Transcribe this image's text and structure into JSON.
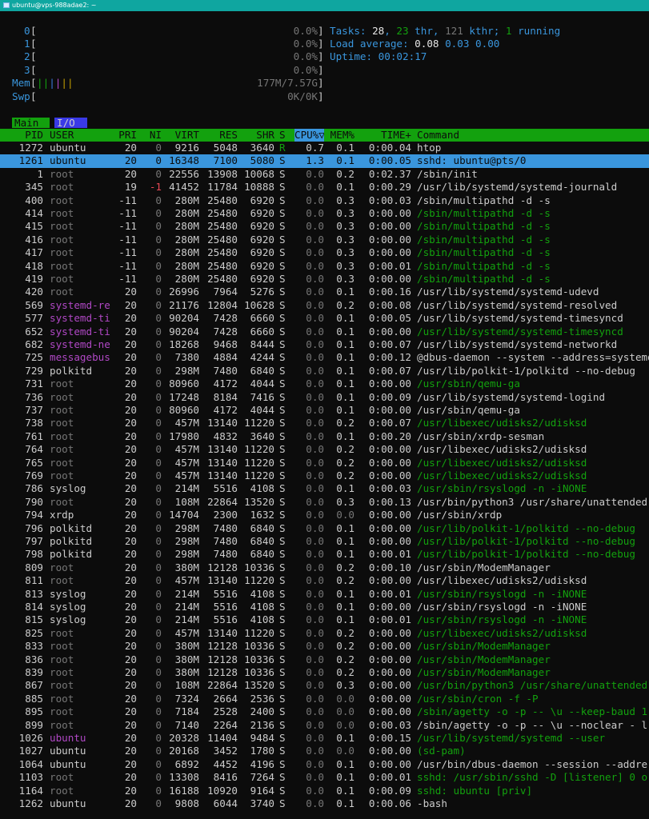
{
  "window": {
    "title": "ubuntu@vps-988adae2: ~"
  },
  "meters": {
    "cpus": [
      {
        "label": "0",
        "value": "0.0%"
      },
      {
        "label": "1",
        "value": "0.0%"
      },
      {
        "label": "2",
        "value": "0.0%"
      },
      {
        "label": "3",
        "value": "0.0%"
      }
    ],
    "mem": {
      "label": "Mem",
      "value": "177M/7.57G"
    },
    "swp": {
      "label": "Swp",
      "value": "0K/0K"
    },
    "tasks": {
      "label": "Tasks: ",
      "procs": "28",
      "sep1": ", ",
      "thr": "23",
      "thr_label": " thr, ",
      "kthr": "121",
      "kthr_label": " kthr; ",
      "running": "1",
      "running_label": " running"
    },
    "load": {
      "label": "Load average: ",
      "l1": "0.08",
      "l5": "0.03",
      "l15": "0.00"
    },
    "uptime": {
      "label": "Uptime: ",
      "value": "00:02:17"
    }
  },
  "tabs": [
    {
      "label": "Main"
    },
    {
      "label": "I/O"
    }
  ],
  "columns": [
    "PID",
    "USER",
    "PRI",
    "NI",
    "VIRT",
    "RES",
    "SHR",
    "S",
    "CPU%▽",
    "MEM%",
    "TIME+",
    "Command"
  ],
  "processes": [
    [
      "1272",
      "ubuntu",
      "20",
      "0",
      "9216",
      "5048",
      "3640",
      "R",
      "0.7",
      "0.1",
      "0:00.04",
      "htop"
    ],
    [
      "1261",
      "ubuntu",
      "20",
      "0",
      "16348",
      "7100",
      "5080",
      "S",
      "1.3",
      "0.1",
      "0:00.05",
      "sshd: ubuntu@pts/0"
    ],
    [
      "1",
      "root",
      "20",
      "0",
      "22556",
      "13908",
      "10068",
      "S",
      "0.0",
      "0.2",
      "0:02.37",
      "/sbin/init"
    ],
    [
      "345",
      "root",
      "19",
      "-1",
      "41452",
      "11784",
      "10888",
      "S",
      "0.0",
      "0.1",
      "0:00.29",
      "/usr/lib/systemd/systemd-journald"
    ],
    [
      "400",
      "root",
      "-11",
      "0",
      "280M",
      "25480",
      "6920",
      "S",
      "0.0",
      "0.3",
      "0:00.03",
      "/sbin/multipathd -d -s"
    ],
    [
      "414",
      "root",
      "-11",
      "0",
      "280M",
      "25480",
      "6920",
      "S",
      "0.0",
      "0.3",
      "0:00.00",
      "/sbin/multipathd -d -s"
    ],
    [
      "415",
      "root",
      "-11",
      "0",
      "280M",
      "25480",
      "6920",
      "S",
      "0.0",
      "0.3",
      "0:00.00",
      "/sbin/multipathd -d -s"
    ],
    [
      "416",
      "root",
      "-11",
      "0",
      "280M",
      "25480",
      "6920",
      "S",
      "0.0",
      "0.3",
      "0:00.00",
      "/sbin/multipathd -d -s"
    ],
    [
      "417",
      "root",
      "-11",
      "0",
      "280M",
      "25480",
      "6920",
      "S",
      "0.0",
      "0.3",
      "0:00.00",
      "/sbin/multipathd -d -s"
    ],
    [
      "418",
      "root",
      "-11",
      "0",
      "280M",
      "25480",
      "6920",
      "S",
      "0.0",
      "0.3",
      "0:00.01",
      "/sbin/multipathd -d -s"
    ],
    [
      "419",
      "root",
      "-11",
      "0",
      "280M",
      "25480",
      "6920",
      "S",
      "0.0",
      "0.3",
      "0:00.00",
      "/sbin/multipathd -d -s"
    ],
    [
      "420",
      "root",
      "20",
      "0",
      "26996",
      "7964",
      "5276",
      "S",
      "0.0",
      "0.1",
      "0:00.16",
      "/usr/lib/systemd/systemd-udevd"
    ],
    [
      "569",
      "systemd-re",
      "20",
      "0",
      "21176",
      "12804",
      "10628",
      "S",
      "0.0",
      "0.2",
      "0:00.08",
      "/usr/lib/systemd/systemd-resolved"
    ],
    [
      "577",
      "systemd-ti",
      "20",
      "0",
      "90204",
      "7428",
      "6660",
      "S",
      "0.0",
      "0.1",
      "0:00.05",
      "/usr/lib/systemd/systemd-timesyncd"
    ],
    [
      "652",
      "systemd-ti",
      "20",
      "0",
      "90204",
      "7428",
      "6660",
      "S",
      "0.0",
      "0.1",
      "0:00.00",
      "/usr/lib/systemd/systemd-timesyncd"
    ],
    [
      "682",
      "systemd-ne",
      "20",
      "0",
      "18268",
      "9468",
      "8444",
      "S",
      "0.0",
      "0.1",
      "0:00.07",
      "/usr/lib/systemd/systemd-networkd"
    ],
    [
      "725",
      "messagebus",
      "20",
      "0",
      "7380",
      "4884",
      "4244",
      "S",
      "0.0",
      "0.1",
      "0:00.12",
      "@dbus-daemon --system --address=systemd"
    ],
    [
      "729",
      "polkitd",
      "20",
      "0",
      "298M",
      "7480",
      "6840",
      "S",
      "0.0",
      "0.1",
      "0:00.07",
      "/usr/lib/polkit-1/polkitd --no-debug"
    ],
    [
      "731",
      "root",
      "20",
      "0",
      "80960",
      "4172",
      "4044",
      "S",
      "0.0",
      "0.1",
      "0:00.00",
      "/usr/sbin/qemu-ga"
    ],
    [
      "736",
      "root",
      "20",
      "0",
      "17248",
      "8184",
      "7416",
      "S",
      "0.0",
      "0.1",
      "0:00.09",
      "/usr/lib/systemd/systemd-logind"
    ],
    [
      "737",
      "root",
      "20",
      "0",
      "80960",
      "4172",
      "4044",
      "S",
      "0.0",
      "0.1",
      "0:00.00",
      "/usr/sbin/qemu-ga"
    ],
    [
      "738",
      "root",
      "20",
      "0",
      "457M",
      "13140",
      "11220",
      "S",
      "0.0",
      "0.2",
      "0:00.07",
      "/usr/libexec/udisks2/udisksd"
    ],
    [
      "761",
      "root",
      "20",
      "0",
      "17980",
      "4832",
      "3640",
      "S",
      "0.0",
      "0.1",
      "0:00.20",
      "/usr/sbin/xrdp-sesman"
    ],
    [
      "764",
      "root",
      "20",
      "0",
      "457M",
      "13140",
      "11220",
      "S",
      "0.0",
      "0.2",
      "0:00.00",
      "/usr/libexec/udisks2/udisksd"
    ],
    [
      "765",
      "root",
      "20",
      "0",
      "457M",
      "13140",
      "11220",
      "S",
      "0.0",
      "0.2",
      "0:00.00",
      "/usr/libexec/udisks2/udisksd"
    ],
    [
      "769",
      "root",
      "20",
      "0",
      "457M",
      "13140",
      "11220",
      "S",
      "0.0",
      "0.2",
      "0:00.00",
      "/usr/libexec/udisks2/udisksd"
    ],
    [
      "786",
      "syslog",
      "20",
      "0",
      "214M",
      "5516",
      "4108",
      "S",
      "0.0",
      "0.1",
      "0:00.03",
      "/usr/sbin/rsyslogd -n -iNONE"
    ],
    [
      "790",
      "root",
      "20",
      "0",
      "108M",
      "22864",
      "13520",
      "S",
      "0.0",
      "0.3",
      "0:00.13",
      "/usr/bin/python3 /usr/share/unattended"
    ],
    [
      "794",
      "xrdp",
      "20",
      "0",
      "14704",
      "2300",
      "1632",
      "S",
      "0.0",
      "0.0",
      "0:00.00",
      "/usr/sbin/xrdp"
    ],
    [
      "796",
      "polkitd",
      "20",
      "0",
      "298M",
      "7480",
      "6840",
      "S",
      "0.0",
      "0.1",
      "0:00.00",
      "/usr/lib/polkit-1/polkitd --no-debug"
    ],
    [
      "797",
      "polkitd",
      "20",
      "0",
      "298M",
      "7480",
      "6840",
      "S",
      "0.0",
      "0.1",
      "0:00.00",
      "/usr/lib/polkit-1/polkitd --no-debug"
    ],
    [
      "798",
      "polkitd",
      "20",
      "0",
      "298M",
      "7480",
      "6840",
      "S",
      "0.0",
      "0.1",
      "0:00.01",
      "/usr/lib/polkit-1/polkitd --no-debug"
    ],
    [
      "809",
      "root",
      "20",
      "0",
      "380M",
      "12128",
      "10336",
      "S",
      "0.0",
      "0.2",
      "0:00.10",
      "/usr/sbin/ModemManager"
    ],
    [
      "811",
      "root",
      "20",
      "0",
      "457M",
      "13140",
      "11220",
      "S",
      "0.0",
      "0.2",
      "0:00.00",
      "/usr/libexec/udisks2/udisksd"
    ],
    [
      "813",
      "syslog",
      "20",
      "0",
      "214M",
      "5516",
      "4108",
      "S",
      "0.0",
      "0.1",
      "0:00.01",
      "/usr/sbin/rsyslogd -n -iNONE"
    ],
    [
      "814",
      "syslog",
      "20",
      "0",
      "214M",
      "5516",
      "4108",
      "S",
      "0.0",
      "0.1",
      "0:00.00",
      "/usr/sbin/rsyslogd -n -iNONE"
    ],
    [
      "815",
      "syslog",
      "20",
      "0",
      "214M",
      "5516",
      "4108",
      "S",
      "0.0",
      "0.1",
      "0:00.01",
      "/usr/sbin/rsyslogd -n -iNONE"
    ],
    [
      "825",
      "root",
      "20",
      "0",
      "457M",
      "13140",
      "11220",
      "S",
      "0.0",
      "0.2",
      "0:00.00",
      "/usr/libexec/udisks2/udisksd"
    ],
    [
      "833",
      "root",
      "20",
      "0",
      "380M",
      "12128",
      "10336",
      "S",
      "0.0",
      "0.2",
      "0:00.00",
      "/usr/sbin/ModemManager"
    ],
    [
      "836",
      "root",
      "20",
      "0",
      "380M",
      "12128",
      "10336",
      "S",
      "0.0",
      "0.2",
      "0:00.00",
      "/usr/sbin/ModemManager"
    ],
    [
      "839",
      "root",
      "20",
      "0",
      "380M",
      "12128",
      "10336",
      "S",
      "0.0",
      "0.2",
      "0:00.00",
      "/usr/sbin/ModemManager"
    ],
    [
      "867",
      "root",
      "20",
      "0",
      "108M",
      "22864",
      "13520",
      "S",
      "0.0",
      "0.3",
      "0:00.00",
      "/usr/bin/python3 /usr/share/unattended"
    ],
    [
      "885",
      "root",
      "20",
      "0",
      "7324",
      "2664",
      "2536",
      "S",
      "0.0",
      "0.0",
      "0:00.00",
      "/usr/sbin/cron -f -P"
    ],
    [
      "895",
      "root",
      "20",
      "0",
      "7184",
      "2528",
      "2400",
      "S",
      "0.0",
      "0.0",
      "0:00.00",
      "/sbin/agetty -o -p -- \\u --keep-baud 1"
    ],
    [
      "899",
      "root",
      "20",
      "0",
      "7140",
      "2264",
      "2136",
      "S",
      "0.0",
      "0.0",
      "0:00.03",
      "/sbin/agetty -o -p -- \\u --noclear - l"
    ],
    [
      "1026",
      "ubuntu",
      "20",
      "0",
      "20328",
      "11404",
      "9484",
      "S",
      "0.0",
      "0.1",
      "0:00.15",
      "/usr/lib/systemd/systemd --user"
    ],
    [
      "1027",
      "ubuntu",
      "20",
      "0",
      "20168",
      "3452",
      "1780",
      "S",
      "0.0",
      "0.0",
      "0:00.00",
      "(sd-pam)"
    ],
    [
      "1064",
      "ubuntu",
      "20",
      "0",
      "6892",
      "4452",
      "4196",
      "S",
      "0.0",
      "0.1",
      "0:00.00",
      "/usr/bin/dbus-daemon --session --addre"
    ],
    [
      "1103",
      "root",
      "20",
      "0",
      "13308",
      "8416",
      "7264",
      "S",
      "0.0",
      "0.1",
      "0:00.01",
      "sshd: /usr/sbin/sshd -D [listener] 0 o"
    ],
    [
      "1164",
      "root",
      "20",
      "0",
      "16188",
      "10920",
      "9164",
      "S",
      "0.0",
      "0.1",
      "0:00.09",
      "sshd: ubuntu [priv]"
    ],
    [
      "1262",
      "ubuntu",
      "20",
      "0",
      "9808",
      "6044",
      "3740",
      "S",
      "0.0",
      "0.1",
      "0:00.06",
      "-bash"
    ]
  ],
  "thread_rows": [
    5,
    6,
    7,
    8,
    9,
    10,
    14,
    18,
    21,
    24,
    25,
    26,
    29,
    30,
    31,
    34,
    36,
    37,
    38,
    39,
    40,
    41,
    42,
    43,
    45,
    46,
    48,
    49
  ],
  "selected_row": 1,
  "colors": {
    "background": "#0c0c0c",
    "header": "#13a10e",
    "selection": "#3a96dd",
    "thread": "#13a10e",
    "meter_label": "#3a96dd"
  }
}
